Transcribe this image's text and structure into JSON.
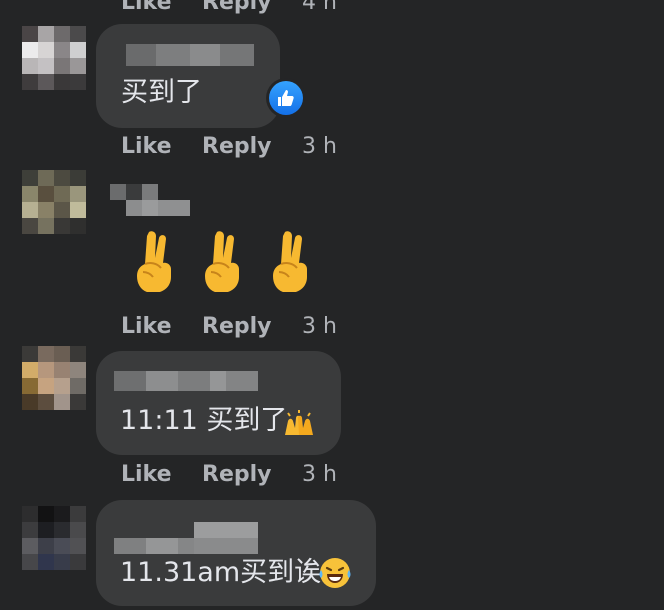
{
  "actions": {
    "like_label": "Like",
    "reply_label": "Reply"
  },
  "top_partial": {
    "like": "Like",
    "reply": "Reply",
    "time": "4 h"
  },
  "comments": [
    {
      "text": "买到了",
      "time": "3 h",
      "reaction": "like-icon"
    },
    {
      "text": "",
      "emojis": [
        "crossed-fingers-icon",
        "crossed-fingers-icon",
        "crossed-fingers-icon"
      ],
      "time": "3 h"
    },
    {
      "text": "11:11 买到了",
      "emoji": "raising-hands-icon",
      "time": "3 h"
    },
    {
      "text": "11.31am买到诶",
      "emoji": "laughing-tears-icon",
      "time": ""
    }
  ],
  "colors": {
    "background": "#242526",
    "bubble": "#3a3b3c",
    "meta": "#b0b3b8",
    "like_blue": "#1877f2"
  }
}
